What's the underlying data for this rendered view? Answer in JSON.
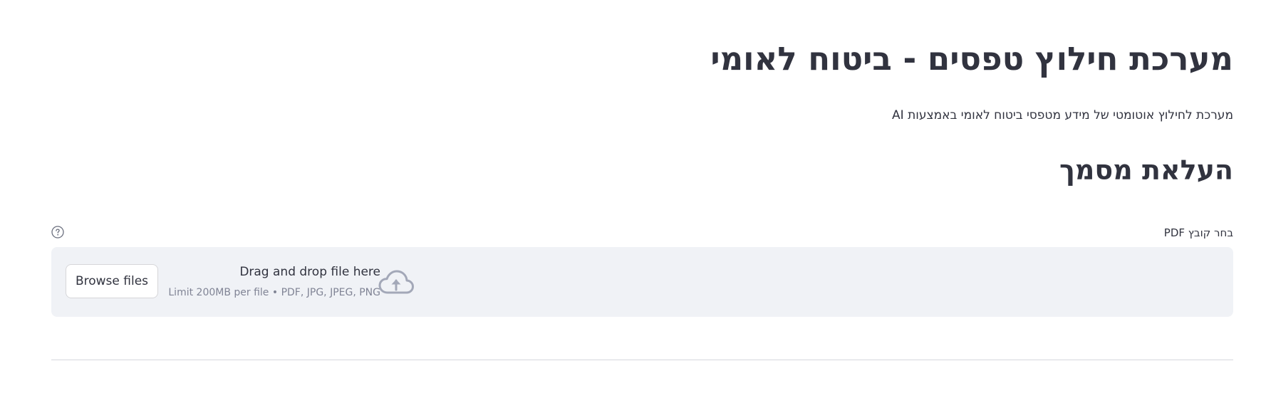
{
  "page": {
    "title": "מערכת חילוץ טפסים - ביטוח לאומי",
    "subtitle": "מערכת לחילוץ אוטומטי של מידע מטפסי ביטוח לאומי באמצעות AI"
  },
  "upload_section": {
    "heading": "העלאת מסמך",
    "field_label": "בחר קובץ PDF",
    "help_icon": "question-circle-icon",
    "dropzone": {
      "instructions": "Drag and drop file here",
      "limits": "Limit 200MB per file • PDF, JPG, JPEG, PNG",
      "browse_label": "Browse files",
      "upload_icon": "cloud-upload-icon"
    }
  },
  "colors": {
    "text": "#31333f",
    "muted": "#808495",
    "dropzone_bg": "#f0f2f6",
    "icon": "#a3a8b8",
    "divider": "#d5d7dd"
  }
}
